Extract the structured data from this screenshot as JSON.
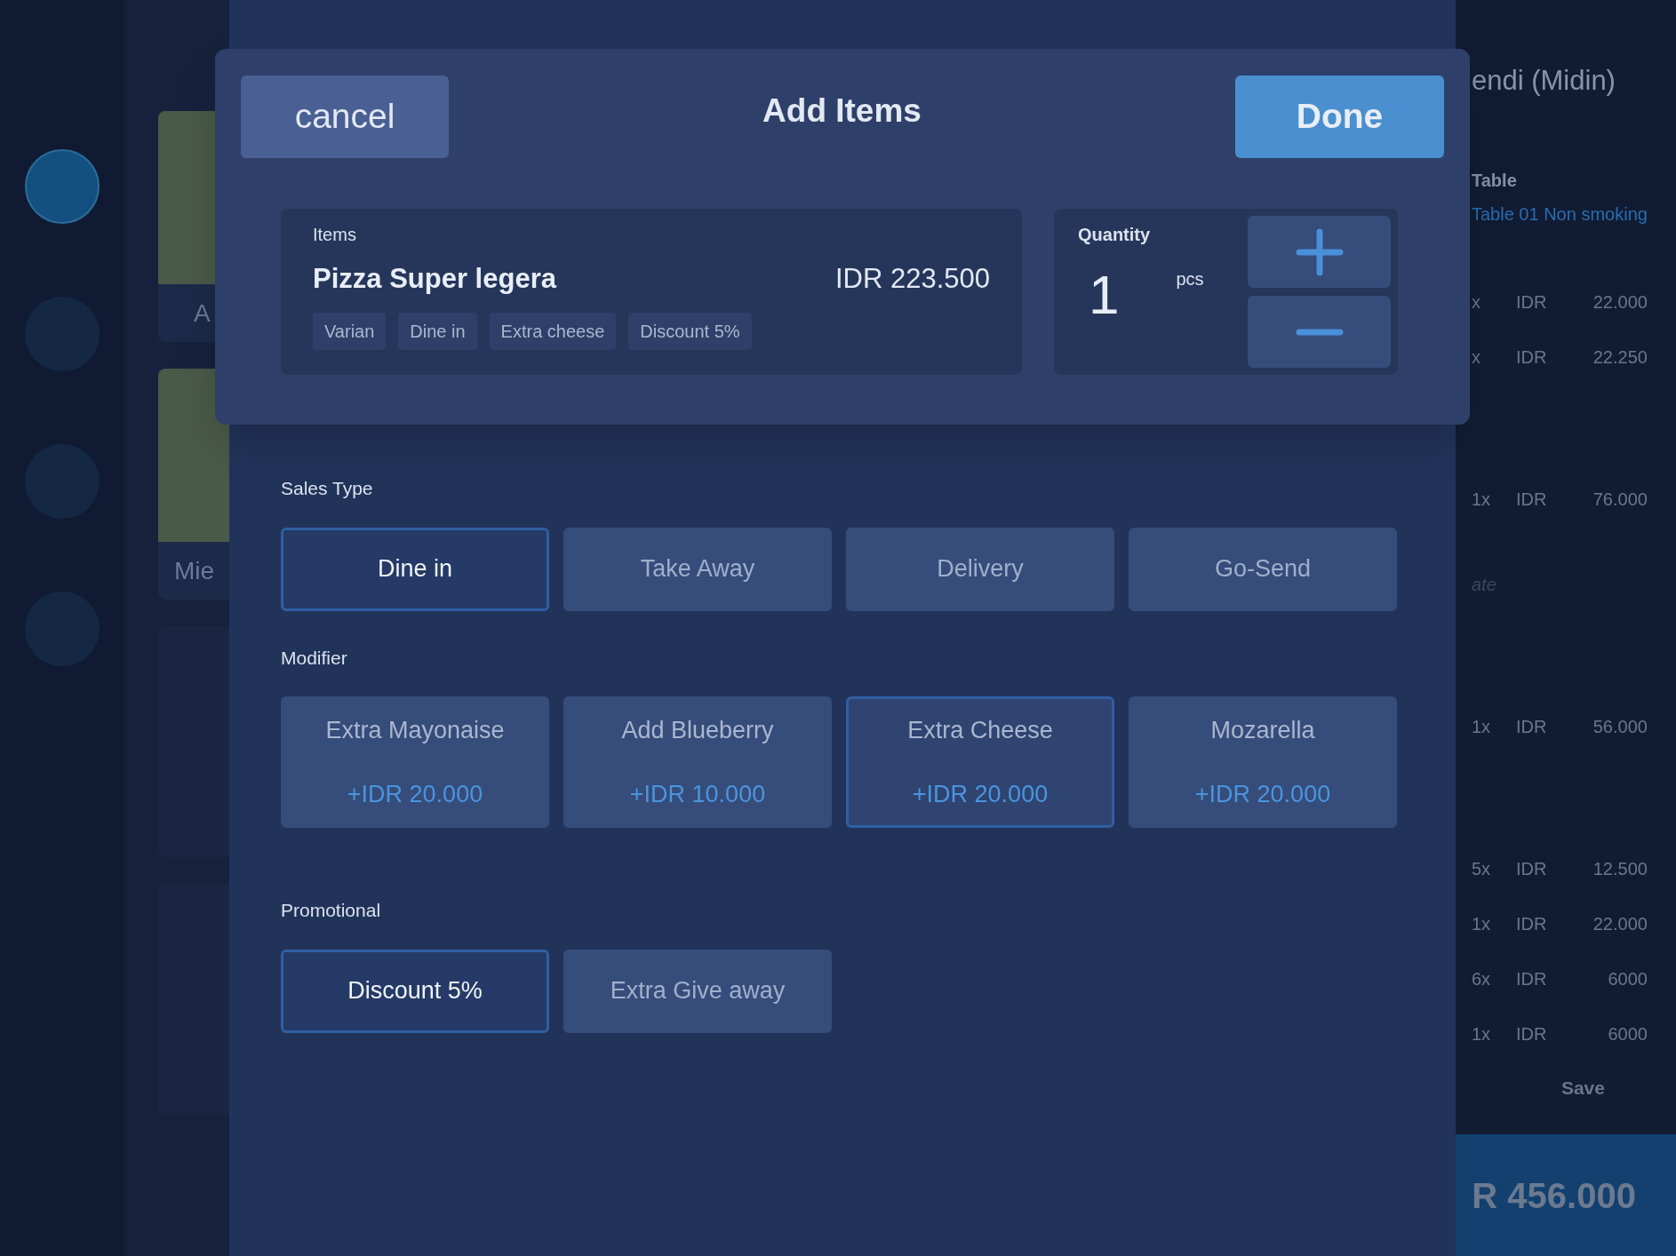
{
  "nav_buttons": [
    {
      "selected": true
    },
    {
      "selected": false
    },
    {
      "selected": false
    },
    {
      "selected": false
    }
  ],
  "product_grid": [
    {
      "kind": "photo",
      "label": "A"
    },
    {
      "kind": "photo",
      "label": "Mie"
    },
    {
      "kind": "empty"
    },
    {
      "kind": "empty"
    }
  ],
  "order_panel": {
    "customer": "endi (Midin)",
    "table_label": "Table",
    "table": "Table 01 Non smoking",
    "sections": [
      {
        "lines": [
          {
            "qty": "x",
            "currency": "IDR",
            "amount": "22.000"
          },
          {
            "qty": "x",
            "currency": "IDR",
            "amount": "22.250"
          }
        ]
      },
      {
        "lines": [
          {
            "qty": "1x",
            "currency": "IDR",
            "amount": "76.000"
          }
        ],
        "note": "ate"
      },
      {
        "lines": [
          {
            "qty": "1x",
            "currency": "IDR",
            "amount": "56.000"
          }
        ]
      },
      {
        "lines": [
          {
            "qty": "5x",
            "currency": "IDR",
            "amount": "12.500"
          },
          {
            "qty": "1x",
            "currency": "IDR",
            "amount": "22.000"
          },
          {
            "qty": "6x",
            "currency": "IDR",
            "amount": "6000"
          },
          {
            "qty": "1x",
            "currency": "IDR",
            "amount": "6000"
          }
        ]
      }
    ],
    "save": "Save",
    "total": "R 456.000"
  },
  "dialog": {
    "cancel": "cancel",
    "title": "Add Items",
    "done": "Done",
    "item": {
      "label": "Items",
      "name": "Pizza Super legera",
      "price": "IDR 223.500",
      "tags": [
        "Varian",
        "Dine in",
        "Extra cheese",
        "Discount 5%"
      ]
    },
    "quantity": {
      "label": "Quantity",
      "value": "1",
      "unit": "pcs"
    }
  },
  "sales_type": {
    "label": "Sales Type",
    "options": [
      {
        "label": "Dine in",
        "selected": true
      },
      {
        "label": "Take Away",
        "selected": false
      },
      {
        "label": "Delivery",
        "selected": false
      },
      {
        "label": "Go-Send",
        "selected": false
      }
    ]
  },
  "modifier": {
    "label": "Modifier",
    "options": [
      {
        "name": "Extra Mayonaise",
        "price": "+IDR 20.000",
        "selected": false
      },
      {
        "name": "Add Blueberry",
        "price": "+IDR 10.000",
        "selected": false
      },
      {
        "name": "Extra Cheese",
        "price": "+IDR 20.000",
        "selected": true
      },
      {
        "name": "Mozarella",
        "price": "+IDR 20.000",
        "selected": false
      }
    ]
  },
  "promotional": {
    "label": "Promotional",
    "options": [
      {
        "label": "Discount 5%",
        "selected": true
      },
      {
        "label": "Extra Give away",
        "selected": false
      }
    ]
  }
}
